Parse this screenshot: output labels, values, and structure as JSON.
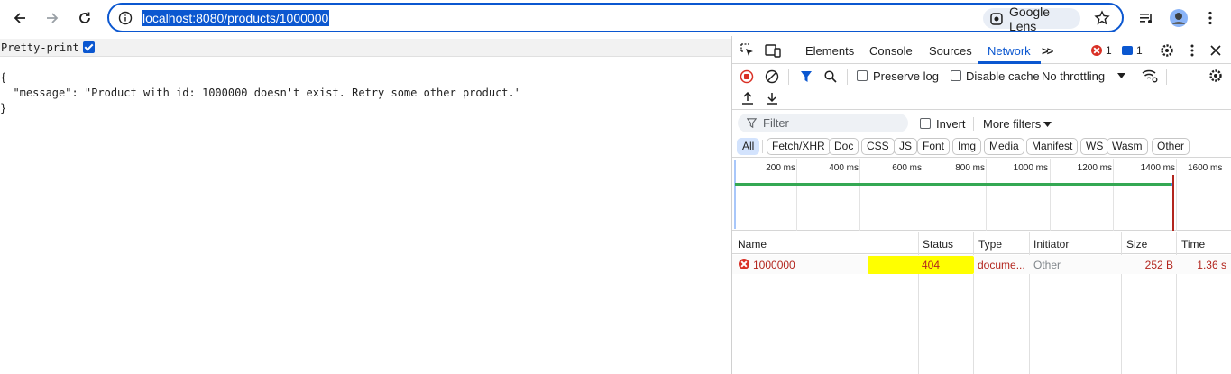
{
  "browser": {
    "url": "localhost:8080/products/1000000",
    "lens_label": "Google Lens"
  },
  "page": {
    "pretty_print_label": "Pretty-print",
    "json_lines": [
      "{",
      "  \"message\": \"Product with id: 1000000 doesn't exist. Retry some other product.\"",
      "}"
    ]
  },
  "devtools": {
    "tabs": [
      "Elements",
      "Console",
      "Sources",
      "Network"
    ],
    "active_tab": "Network",
    "more_tabs": ">>",
    "error_count": "1",
    "message_count": "1",
    "toolbar": {
      "preserve_log": "Preserve log",
      "disable_cache": "Disable cache",
      "throttling": "No throttling"
    },
    "filter": {
      "placeholder": "Filter",
      "invert": "Invert",
      "more_filters": "More filters"
    },
    "type_chips": [
      "All",
      "Fetch/XHR",
      "Doc",
      "CSS",
      "JS",
      "Font",
      "Img",
      "Media",
      "Manifest",
      "WS",
      "Wasm",
      "Other"
    ],
    "timeline_ticks": [
      "200 ms",
      "400 ms",
      "600 ms",
      "800 ms",
      "1000 ms",
      "1200 ms",
      "1400 ms",
      "1600 ms"
    ],
    "table": {
      "headers": [
        "Name",
        "Status",
        "Type",
        "Initiator",
        "Size",
        "Time"
      ],
      "rows": [
        {
          "name": "1000000",
          "status": "404",
          "type": "docume...",
          "initiator": "Other",
          "size": "252 B",
          "time": "1.36 s"
        }
      ]
    },
    "colors": {
      "accent": "#0b57d0",
      "error": "#b3261e",
      "highlight": "#ffff00"
    }
  }
}
